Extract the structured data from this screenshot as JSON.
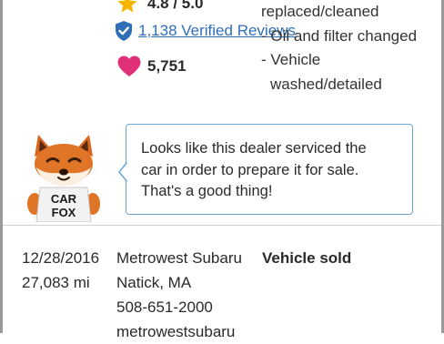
{
  "dealer_summary": {
    "rating": "4.8 / 5.0",
    "reviews_link": "1,138 Verified Reviews",
    "favorites_count": "5,751"
  },
  "service_notes": [
    "replaced/cleaned",
    "- Oil and filter changed",
    "- Vehicle",
    "washed/detailed"
  ],
  "carfox_message": {
    "line1": "Looks like this dealer serviced the",
    "line2": "car in order to prepare it for sale.",
    "line3": "That's a good thing!"
  },
  "history_record": {
    "date": "12/28/2016",
    "odometer": "27,083 mi",
    "dealer_name": "Metrowest Subaru",
    "dealer_location": "Natick, MA",
    "dealer_phone": "508-651-2000",
    "dealer_site": "metrowestsubaru",
    "event": "Vehicle sold"
  },
  "mascot": {
    "shirt_line1": "CAR",
    "shirt_line2": "FOX"
  },
  "colors": {
    "star": "#f7b500",
    "shield": "#2f6fb8",
    "heart": "#e0307a",
    "link": "#2f6fb8",
    "bubble_border": "#6aa8d8"
  }
}
